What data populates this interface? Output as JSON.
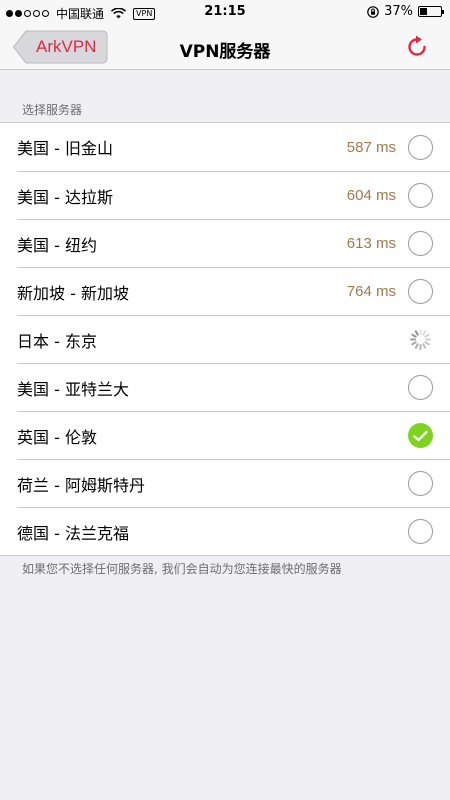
{
  "status_bar": {
    "carrier": "中国联通",
    "vpn_badge": "VPN",
    "time": "21:15",
    "battery_percent": "37%",
    "battery_level": 0.37,
    "signal_bars_filled": 2,
    "signal_bars_total": 5
  },
  "nav": {
    "back_label": "ArkVPN",
    "title": "VPN服务器",
    "accent_color": "#e0283f"
  },
  "section": {
    "header": "选择服务器",
    "footer": "如果您不选择任何服务器, 我们会自动为您连接最快的服务器"
  },
  "servers": [
    {
      "label": "美国 - 旧金山",
      "ping": "587 ms",
      "state": "unselected"
    },
    {
      "label": "美国 - 达拉斯",
      "ping": "604 ms",
      "state": "unselected"
    },
    {
      "label": "美国 - 纽约",
      "ping": "613 ms",
      "state": "unselected"
    },
    {
      "label": "新加坡 - 新加坡",
      "ping": "764 ms",
      "state": "unselected"
    },
    {
      "label": "日本 - 东京",
      "ping": "",
      "state": "loading"
    },
    {
      "label": "美国 - 亚特兰大",
      "ping": "",
      "state": "unselected"
    },
    {
      "label": "英国 - 伦敦",
      "ping": "",
      "state": "selected"
    },
    {
      "label": "荷兰 - 阿姆斯特丹",
      "ping": "",
      "state": "unselected"
    },
    {
      "label": "德国 - 法兰克福",
      "ping": "",
      "state": "unselected"
    }
  ],
  "colors": {
    "selected_check": "#7ed321",
    "ping_text": "#a07a4a"
  },
  "icons": {
    "back": "back-arrow-icon",
    "refresh": "refresh-icon",
    "selected": "checkmark-icon",
    "unselected": "radio-empty-icon",
    "loading": "spinner-icon"
  }
}
